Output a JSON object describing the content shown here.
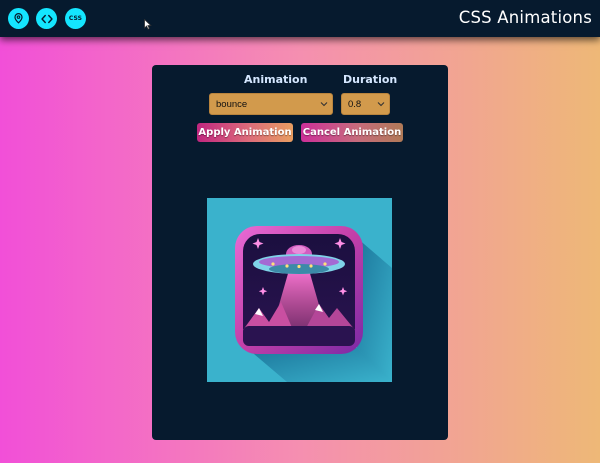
{
  "header": {
    "title": "CSS Animations",
    "icons": [
      "map-pin-icon",
      "code-icon",
      "css-icon"
    ],
    "css_icon_text": "CSS",
    "accent_color": "#14e6ff",
    "background_color": "#061a2e"
  },
  "controls": {
    "animation_label": "Animation",
    "duration_label": "Duration",
    "animation_value": "bounce",
    "duration_value": "0.8",
    "apply_label": "Apply Animation",
    "cancel_label": "Cancel Animation"
  },
  "preview": {
    "image": "ufo-app-icon",
    "background_color": "#3ab2cc"
  }
}
